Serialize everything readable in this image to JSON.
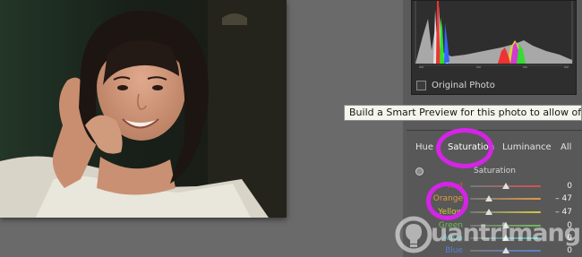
{
  "histogram": {
    "original_photo_label": "Original Photo"
  },
  "tooltip": {
    "text": "Build a Smart Preview for this photo to allow offli"
  },
  "hsl_panel": {
    "tabs": [
      {
        "label": "Hue",
        "active": false
      },
      {
        "label": "Saturation",
        "active": true
      },
      {
        "label": "Luminance",
        "active": false
      },
      {
        "label": "All",
        "active": false
      }
    ],
    "section_label": "Saturation",
    "sliders": [
      {
        "label": "Red",
        "value": "0",
        "level": 0,
        "color": "#d85050"
      },
      {
        "label": "Orange",
        "value": "– 47",
        "level": -47,
        "color": "#e39a41"
      },
      {
        "label": "Yellow",
        "value": "– 47",
        "level": -47,
        "color": "#d4c940"
      },
      {
        "label": "Green",
        "value": "0",
        "level": 0,
        "color": "#6ebb58"
      },
      {
        "label": "Aqua",
        "value": "0",
        "level": 0,
        "color": "#54b6b6"
      },
      {
        "label": "Blue",
        "value": "0",
        "level": 0,
        "color": "#5c7ed4"
      }
    ]
  },
  "watermark": {
    "text": "uantrimang",
    "logo_icon": "lightbulb-icon"
  },
  "colors": {
    "highlight": "#d524e7",
    "panel_bg": "#585858",
    "tooltip_bg": "#f5f5ee"
  }
}
